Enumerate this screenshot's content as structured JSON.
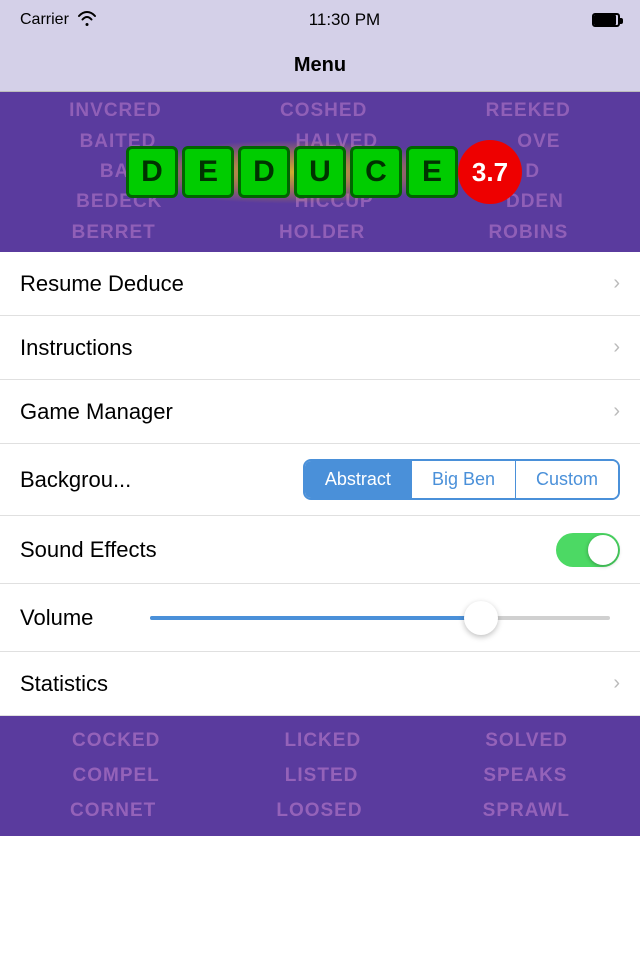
{
  "statusBar": {
    "carrier": "Carrier",
    "time": "11:30 PM",
    "wifi": "wifi"
  },
  "navBar": {
    "title": "Menu"
  },
  "hero": {
    "wordRows": [
      [
        "INVCRED",
        "COSHED",
        "REEKED"
      ],
      [
        "BAITED",
        "HALVED",
        "OVE"
      ],
      [
        "BA",
        "DEDUCE",
        "D"
      ],
      [
        "BEDECK",
        "HICCUP",
        "DDEN"
      ],
      [
        "BERRET",
        "HOLDER",
        "ROBINS"
      ]
    ],
    "tiles": [
      "D",
      "E",
      "D",
      "U",
      "C",
      "E"
    ],
    "version": "3.7"
  },
  "menuItems": [
    {
      "label": "Resume Deduce",
      "hasChevron": true
    },
    {
      "label": "Instructions",
      "hasChevron": true
    },
    {
      "label": "Game Manager",
      "hasChevron": true
    }
  ],
  "backgroundRow": {
    "label": "Backgrou...",
    "options": [
      "Abstract",
      "Big Ben",
      "Custom"
    ],
    "selectedIndex": 0
  },
  "soundEffects": {
    "label": "Sound Effects",
    "enabled": true
  },
  "volume": {
    "label": "Volume",
    "value": 72
  },
  "statistics": {
    "label": "Statistics",
    "hasChevron": true
  },
  "bottomWords": [
    [
      "COCKED",
      "LICKED",
      "SOLVED"
    ],
    [
      "COMPEL",
      "LISTED",
      "SPEAKS"
    ],
    [
      "CORNET",
      "LOOSED",
      "SPRAWL"
    ]
  ]
}
